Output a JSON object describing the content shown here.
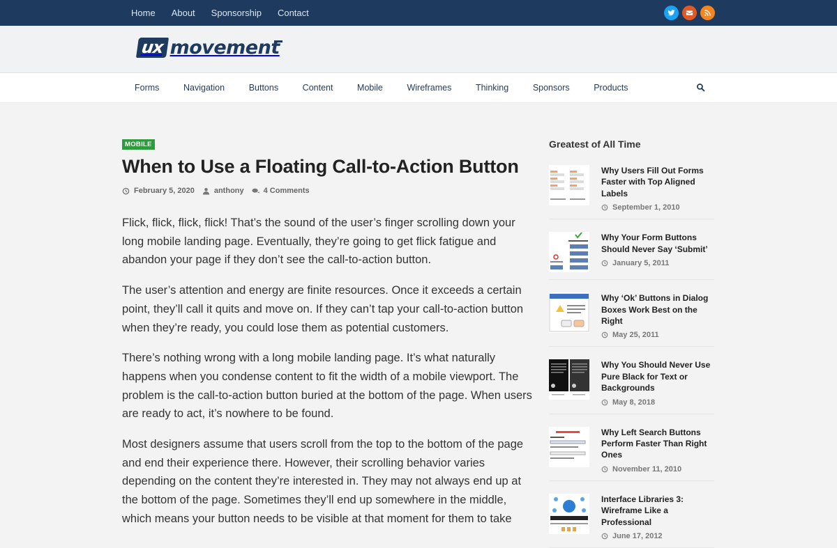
{
  "topnav": {
    "items": [
      "Home",
      "About",
      "Sponsorship",
      "Contact"
    ],
    "social": [
      {
        "icon": "twitter-icon",
        "color": "#1da1f2"
      },
      {
        "icon": "mail-icon",
        "color": "#e05a28"
      },
      {
        "icon": "rss-icon",
        "color": "#f3861f"
      }
    ]
  },
  "logo": {
    "ux": "ux",
    "name": "movement"
  },
  "catnav": {
    "items": [
      "Forms",
      "Navigation",
      "Buttons",
      "Content",
      "Mobile",
      "Wireframes",
      "Thinking",
      "Sponsors",
      "Products"
    ]
  },
  "article": {
    "category": "MOBILE",
    "title": "When to Use a Floating Call-to-Action Button",
    "date": "February 5, 2020",
    "author": "anthony",
    "comments": "4 Comments",
    "paragraphs": [
      "Flick, flick, flick, flick! That’s the sound of the user’s finger scrolling down your long mobile landing page. Eventually, they’re going to get flick fatigue and abandon your page if they don’t see the call-to-action button.",
      "The user’s attention and energy are finite resources. Once it exceeds a certain point, they’ll call it quits and move on. If they can’t tap your call-to-action button when they’re ready, you could lose them as potential customers.",
      "There’s nothing wrong with a long mobile landing page. It’s what naturally happens when you condense content to fit the width of a mobile viewport. The problem is the call-to-action button buried at the bottom of the page. When users are ready to act, it’s nowhere to be found.",
      "Most designers assume that users scroll from the top to the bottom of the page and end their experience there. However, their scrolling behavior varies depending on the content they’re interested in. They may not always end up at the bottom of the page. Sometimes they’ll end up somewhere in the middle, which means your button needs to be visible at that moment for them to take"
    ]
  },
  "sidebar": {
    "title": "Greatest of All Time",
    "posts": [
      {
        "title": "Why Users Fill Out Forms Faster with Top Aligned Labels",
        "date": "September 1, 2010"
      },
      {
        "title": "Why Your Form Buttons Should Never Say ‘Submit’",
        "date": "January 5, 2011"
      },
      {
        "title": "Why ‘Ok’ Buttons in Dialog Boxes Work Best on the Right",
        "date": "May 25, 2011"
      },
      {
        "title": "Why You Should Never Use Pure Black for Text or Backgrounds",
        "date": "May 8, 2018"
      },
      {
        "title": "Why Left Search Buttons Perform Faster Than Right Ones",
        "date": "November 11, 2010"
      },
      {
        "title": "Interface Libraries 3: Wireframe Like a Professional",
        "date": "June 17, 2012"
      }
    ]
  }
}
